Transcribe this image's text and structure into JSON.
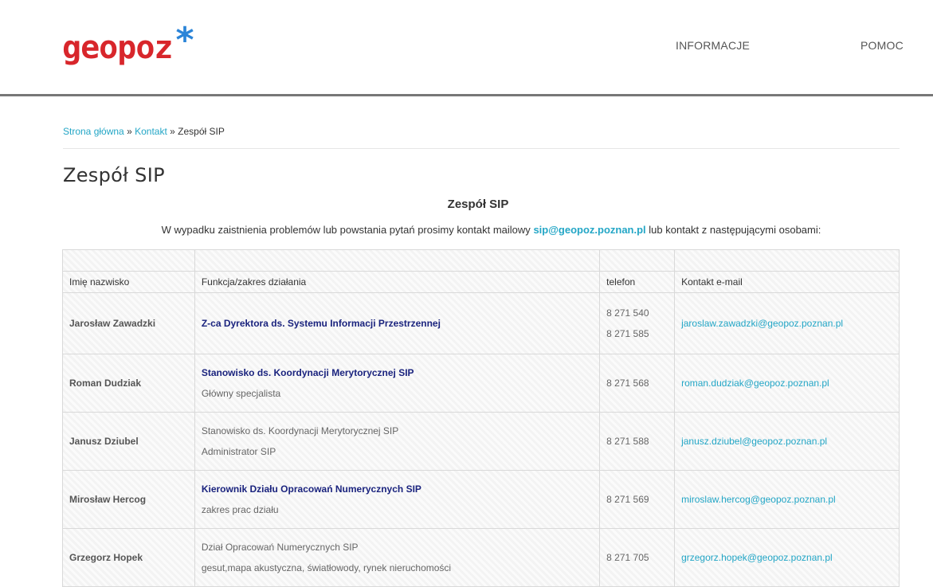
{
  "header": {
    "logo_text": "geopoz",
    "logo_star": "*",
    "nav": [
      "INFORMACJE",
      "POMOC"
    ]
  },
  "breadcrumb": {
    "home": "Strona główna",
    "sep": "»",
    "contact": "Kontakt",
    "current": "Zespół SIP"
  },
  "page_title": "Zespół SIP",
  "section_title": "Zespół SIP",
  "intro": {
    "before": "W wypadku zaistnienia problemów lub powstania pytań prosimy kontakt mailowy",
    "email": "sip@geopoz.poznan.pl",
    "after": "lub kontakt z następującymi osobami:"
  },
  "table": {
    "headers": [
      "Imię nazwisko",
      "Funkcja/zakres działania",
      "telefon",
      "Kontakt e-mail"
    ],
    "rows": [
      {
        "name": "Jarosław Zawadzki",
        "func1": "Z-ca Dyrektora ds. Systemu Informacji Przestrzennej",
        "func2": "",
        "phone1": "8 271 540",
        "phone2": "8 271 585",
        "email": "jaroslaw.zawadzki@geopoz.poznan.pl"
      },
      {
        "name": "Roman Dudziak",
        "func1": "Stanowisko ds. Koordynacji Merytorycznej SIP",
        "func2": "Główny specjalista",
        "phone1": "8 271 568",
        "phone2": "",
        "email": "roman.dudziak@geopoz.poznan.pl"
      },
      {
        "name": "Janusz Dziubel",
        "func1": "Stanowisko ds. Koordynacji Merytorycznej SIP",
        "func2": "Administrator SIP",
        "phone1": "8 271 588",
        "phone2": "",
        "email": "janusz.dziubel@geopoz.poznan.pl"
      },
      {
        "name": "Mirosław Hercog",
        "func1": "Kierownik Działu Opracowań Numerycznych SIP",
        "func2": "zakres prac działu",
        "phone1": "8 271 569",
        "phone2": "",
        "email": "miroslaw.hercog@geopoz.poznan.pl"
      },
      {
        "name": "Grzegorz Hopek",
        "func1": "Dział Opracowań Numerycznych SIP",
        "func2": "gesut,mapa akustyczna, światłowody, rynek nieruchomości",
        "phone1": "8 271 705",
        "phone2": "",
        "email": "grzegorz.hopek@geopoz.poznan.pl"
      }
    ]
  },
  "colors": {
    "logo_red": "#d8262b",
    "logo_blue": "#2a84d8",
    "link": "#23a6c6",
    "function_bold": "#1a237e"
  }
}
